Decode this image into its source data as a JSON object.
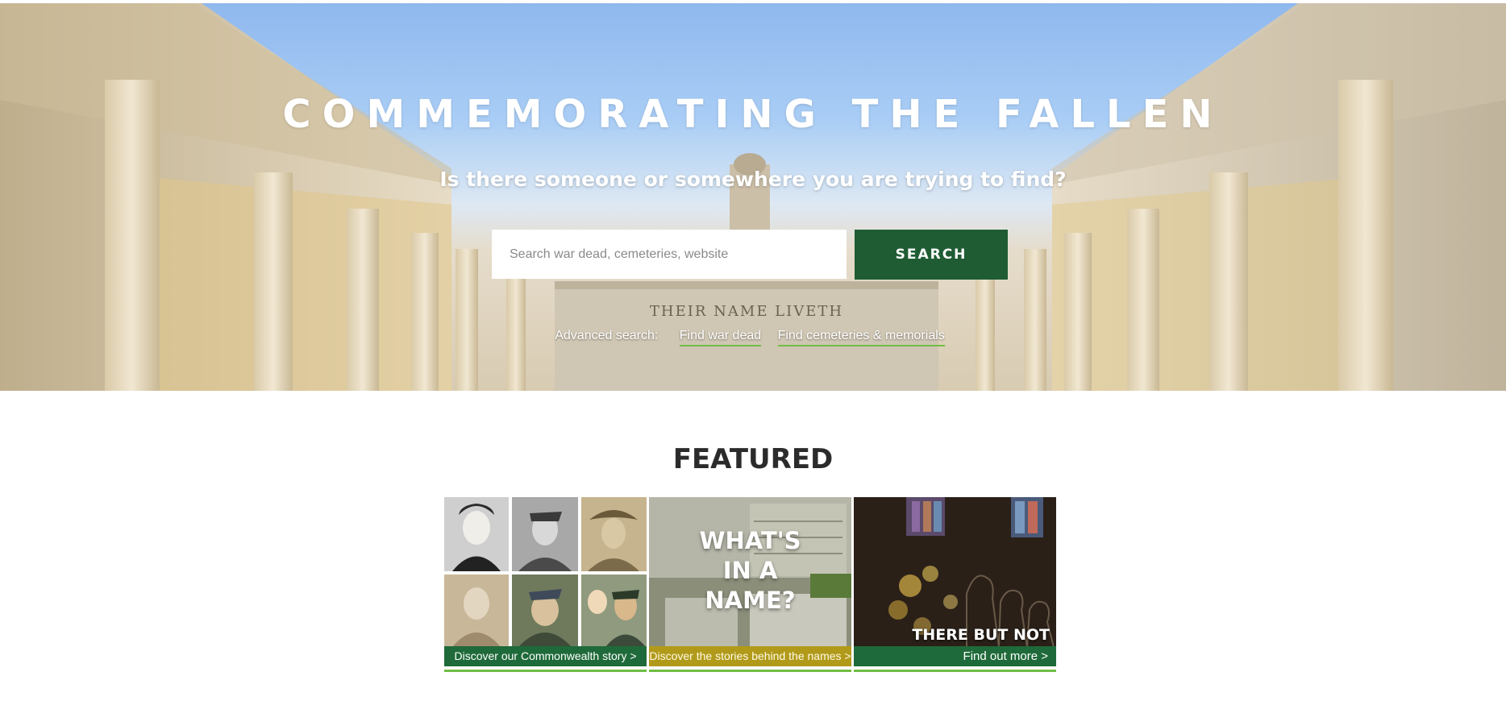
{
  "hero": {
    "title": "COMMEMORATING THE FALLEN",
    "subtitle": "Is there someone or somewhere you are trying to find?",
    "inscription": "THEIR NAME LIVETH",
    "search": {
      "placeholder": "Search war dead, cemeteries, website",
      "value": "",
      "button_label": "SEARCH"
    },
    "advanced": {
      "label": "Advanced search:",
      "links": [
        "Find war dead",
        "Find cemeteries & memorials"
      ]
    }
  },
  "featured": {
    "title": "FEATURED",
    "cards": [
      {
        "image": "portrait-collage",
        "heading": "",
        "caption": "Discover our Commonwealth story  >"
      },
      {
        "image": "memorial-names-wall",
        "heading": "WHAT'S\nIN A\nNAME?",
        "caption": "Discover the stories behind the names >"
      },
      {
        "image": "church-silhouettes",
        "heading": "THERE BUT NOT THERE",
        "caption": "Find out more >"
      }
    ]
  },
  "colors": {
    "brand_green": "#1f5c34",
    "caption_green": "#1f6a3a",
    "caption_gold": "#b19a1a",
    "accent_green": "#6fbe44",
    "heading_text": "#2b2b2b"
  },
  "icons": {
    "card_arrow": "chevron-right-icon"
  }
}
